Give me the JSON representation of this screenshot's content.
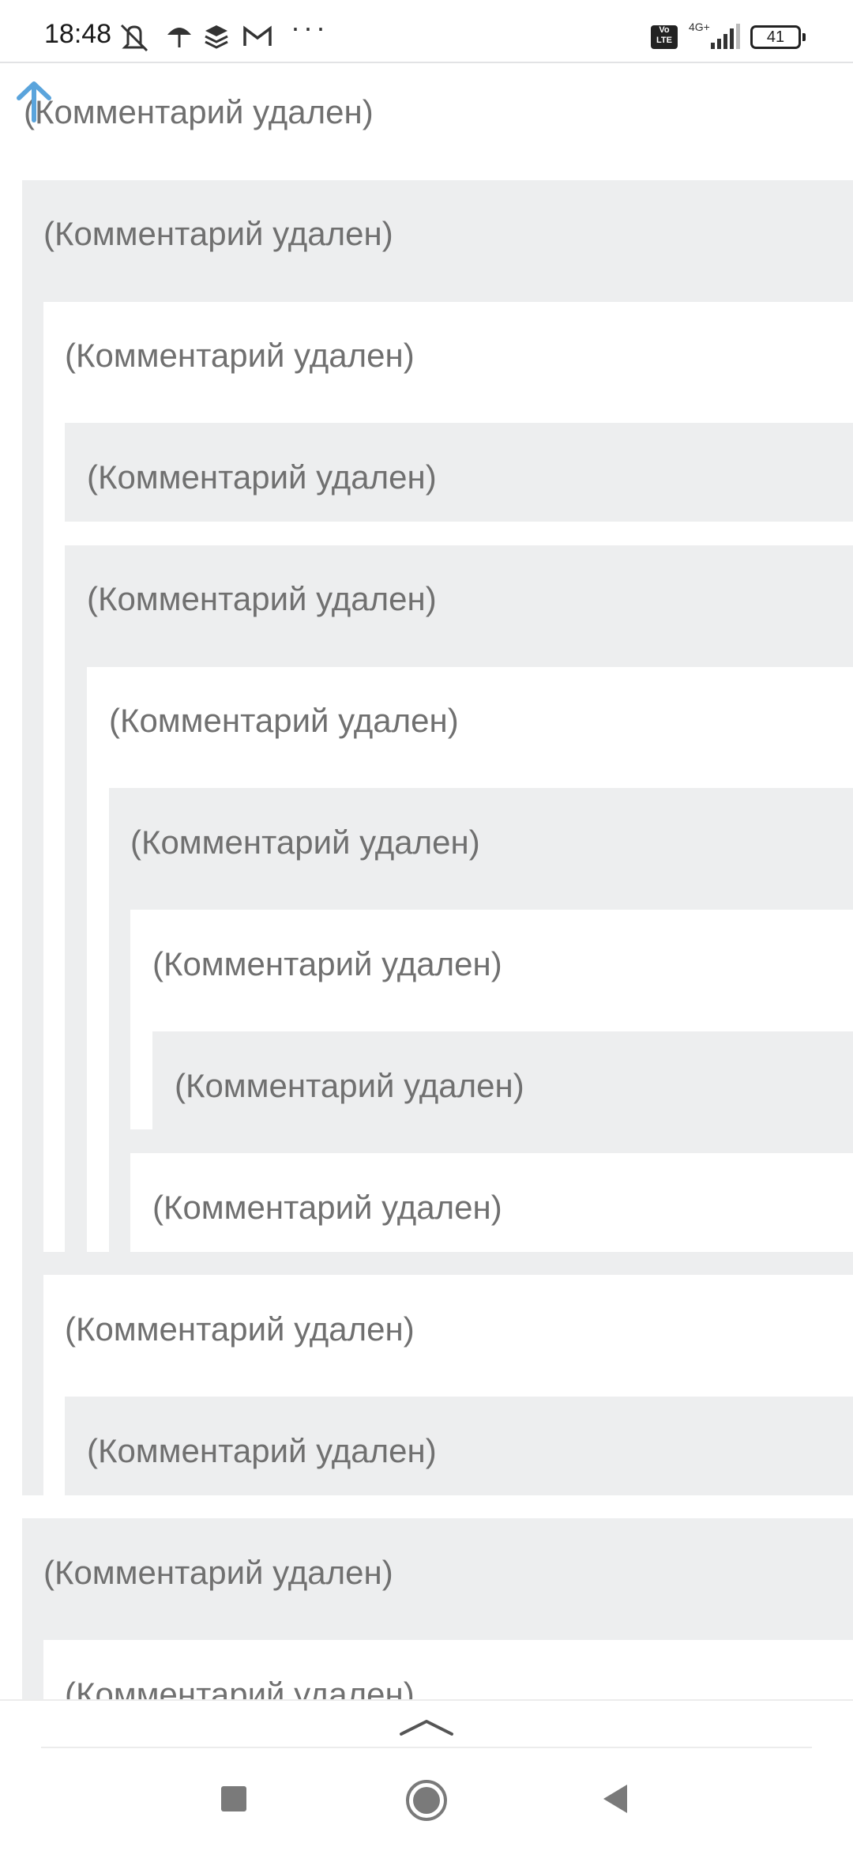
{
  "status_bar": {
    "time": "18:48",
    "network": "4G+",
    "volte": "Vo LTE",
    "battery": "41",
    "more": "···"
  },
  "comments": [
    "(Комментарий удален)",
    "(Комментарий удален)",
    "(Комментарий удален)",
    "(Комментарий удален)",
    "(Комментарий удален)",
    "(Комментарий удален)",
    "(Комментарий удален)",
    "(Комментарий удален)",
    "(Комментарий удален)",
    "(Комментарий удален)",
    "(Комментарий удален)",
    "(Комментарий удален)",
    "(Комментарий удален)",
    "(Комментарий удален)"
  ],
  "colors": {
    "accent": "#5aa4dc",
    "thread_gray": "#edeeef",
    "text": "#707070"
  }
}
